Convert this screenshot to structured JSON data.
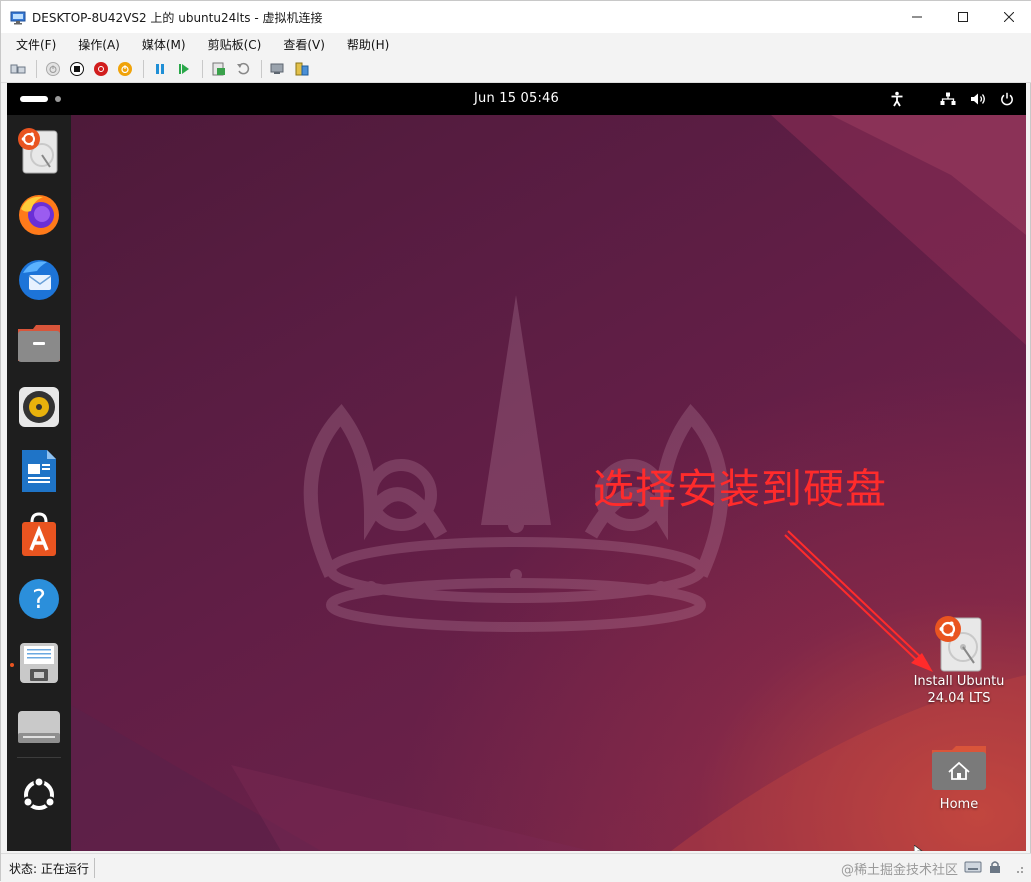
{
  "window": {
    "title": "DESKTOP-8U42VS2 上的 ubuntu24lts - 虚拟机连接",
    "minimize": "—",
    "maximize": "☐",
    "close": "✕"
  },
  "menu": [
    {
      "label": "文件(F)"
    },
    {
      "label": "操作(A)"
    },
    {
      "label": "媒体(M)"
    },
    {
      "label": "剪贴板(C)"
    },
    {
      "label": "查看(V)"
    },
    {
      "label": "帮助(H)"
    }
  ],
  "vm": {
    "clock": "Jun 15  05:46",
    "desktop_icons": [
      {
        "label_line1": "Install Ubuntu",
        "label_line2": "24.04 LTS"
      },
      {
        "label_line1": "Home"
      }
    ],
    "annotation": "选择安装到硬盘",
    "colors": {
      "ubuntu_orange": "#e95420",
      "annotation_red": "#ff2b2b"
    }
  },
  "status": {
    "text": "状态: 正在运行",
    "watermark": "@稀土掘金技术社区"
  }
}
